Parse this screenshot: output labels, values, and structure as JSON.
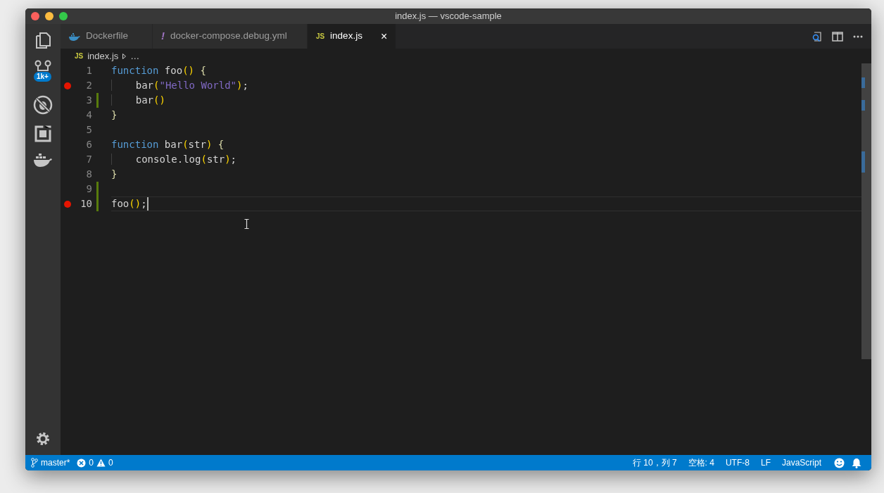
{
  "window": {
    "title": "index.js — vscode-sample"
  },
  "activity_bar": {
    "badge": "1k+"
  },
  "tabs": [
    {
      "kind": "docker",
      "label": "Dockerfile",
      "selected": false
    },
    {
      "kind": "yaml",
      "icon_text": "!",
      "label": "docker-compose.debug.yml",
      "selected": false
    },
    {
      "kind": "js",
      "icon_text": "JS",
      "label": "index.js",
      "selected": true,
      "close": "×"
    }
  ],
  "breadcrumb": {
    "icon_text": "JS",
    "items": [
      "index.js",
      "…"
    ]
  },
  "lines": [
    {
      "number": "1",
      "breakpoint": false,
      "changed": false,
      "current": false,
      "tokens": [
        {
          "kind": "keyword",
          "t": "function"
        },
        {
          "kind": "plain",
          "t": " foo"
        },
        {
          "kind": "paren",
          "t": "()"
        },
        {
          "kind": "brace",
          "t": " {"
        }
      ]
    },
    {
      "number": "2",
      "breakpoint": true,
      "changed": false,
      "current": false,
      "indented": true,
      "tokens": [
        {
          "kind": "plain",
          "t": "bar"
        },
        {
          "kind": "paren",
          "t": "("
        },
        {
          "kind": "string",
          "t": "\"Hello World\""
        },
        {
          "kind": "paren",
          "t": ")"
        },
        {
          "kind": "plain",
          "t": ";"
        }
      ]
    },
    {
      "number": "3",
      "breakpoint": false,
      "changed": true,
      "current": false,
      "indented": true,
      "tokens": [
        {
          "kind": "plain",
          "t": "bar"
        },
        {
          "kind": "paren",
          "t": "()"
        }
      ]
    },
    {
      "number": "4",
      "breakpoint": false,
      "changed": false,
      "current": false,
      "tokens": [
        {
          "kind": "brace",
          "t": "}"
        }
      ]
    },
    {
      "number": "5",
      "breakpoint": false,
      "changed": false,
      "current": false
    },
    {
      "number": "6",
      "breakpoint": false,
      "changed": false,
      "current": false,
      "tokens": [
        {
          "kind": "keyword",
          "t": "function"
        },
        {
          "kind": "plain",
          "t": " bar"
        },
        {
          "kind": "paren",
          "t": "("
        },
        {
          "kind": "plain",
          "t": "str"
        },
        {
          "kind": "paren",
          "t": ")"
        },
        {
          "kind": "brace",
          "t": " {"
        }
      ]
    },
    {
      "number": "7",
      "breakpoint": false,
      "changed": false,
      "current": false,
      "indented": true,
      "tokens": [
        {
          "kind": "plain",
          "t": "console.log"
        },
        {
          "kind": "paren",
          "t": "("
        },
        {
          "kind": "plain",
          "t": "str"
        },
        {
          "kind": "paren",
          "t": ")"
        },
        {
          "kind": "plain",
          "t": ";"
        }
      ]
    },
    {
      "number": "8",
      "breakpoint": false,
      "changed": false,
      "current": false,
      "tokens": [
        {
          "kind": "brace",
          "t": "}"
        }
      ]
    },
    {
      "number": "9",
      "breakpoint": false,
      "changed": true,
      "current": false
    },
    {
      "number": "10",
      "breakpoint": true,
      "changed": true,
      "current": true,
      "tokens": [
        {
          "kind": "plain",
          "t": "foo"
        },
        {
          "kind": "paren",
          "t": "()"
        },
        {
          "kind": "plain",
          "t": ";"
        }
      ]
    }
  ],
  "status_bar": {
    "branch": "master*",
    "errors": "0",
    "warnings": "0",
    "items": [
      "行 10，列 7",
      "空格: 4",
      "UTF-8",
      "LF",
      "JavaScript"
    ]
  }
}
